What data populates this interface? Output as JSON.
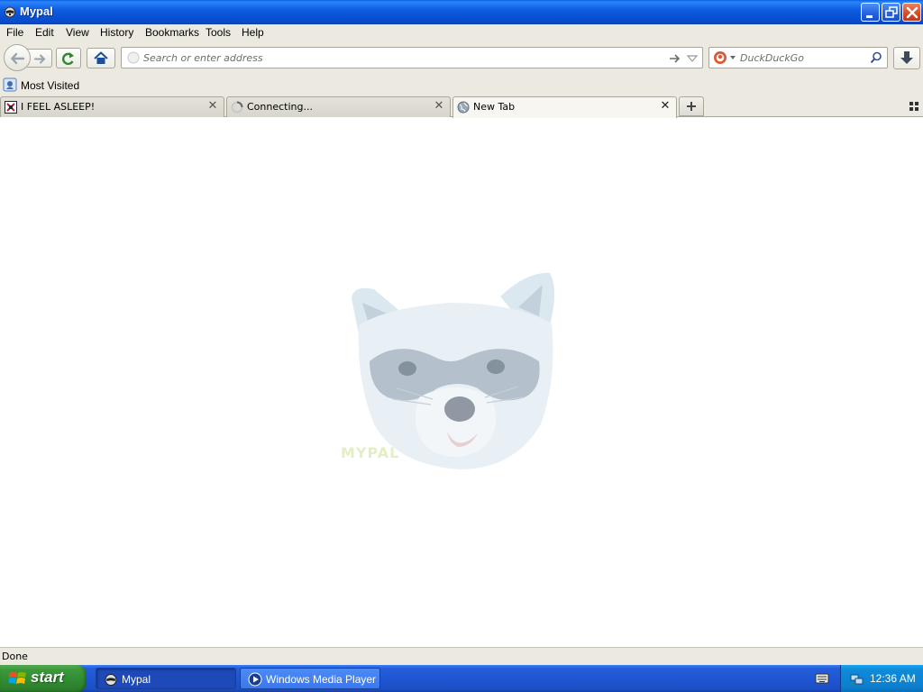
{
  "window": {
    "title": "Mypal"
  },
  "menu": {
    "items": [
      {
        "label": "File"
      },
      {
        "label": "Edit"
      },
      {
        "label": "View"
      },
      {
        "label": "History"
      },
      {
        "label": "Bookmarks"
      },
      {
        "label": "Tools"
      },
      {
        "label": "Help"
      }
    ]
  },
  "navbar": {
    "url_placeholder": "Search or enter address",
    "search_placeholder": "DuckDuckGo"
  },
  "bookmarks": {
    "items": [
      {
        "label": "Most Visited"
      }
    ]
  },
  "tabs": [
    {
      "label": "I FEEL ASLEEP!",
      "active": false
    },
    {
      "label": "Connecting...",
      "active": false
    },
    {
      "label": "New Tab",
      "active": true
    }
  ],
  "content": {
    "logo_text": "MYPAL"
  },
  "status": {
    "text": "Done"
  },
  "taskbar": {
    "start_label": "start",
    "tasks": [
      {
        "label": "Mypal",
        "active": true
      },
      {
        "label": "Windows Media Player",
        "active": false
      }
    ],
    "clock": "12:36 AM"
  },
  "colors": {
    "titlebar_blue": "#0a5fe6",
    "chrome_bg": "#ebe9e0",
    "taskbar_blue": "#245edb",
    "start_green": "#3c9a3c",
    "tray_blue": "#0b80cf"
  }
}
